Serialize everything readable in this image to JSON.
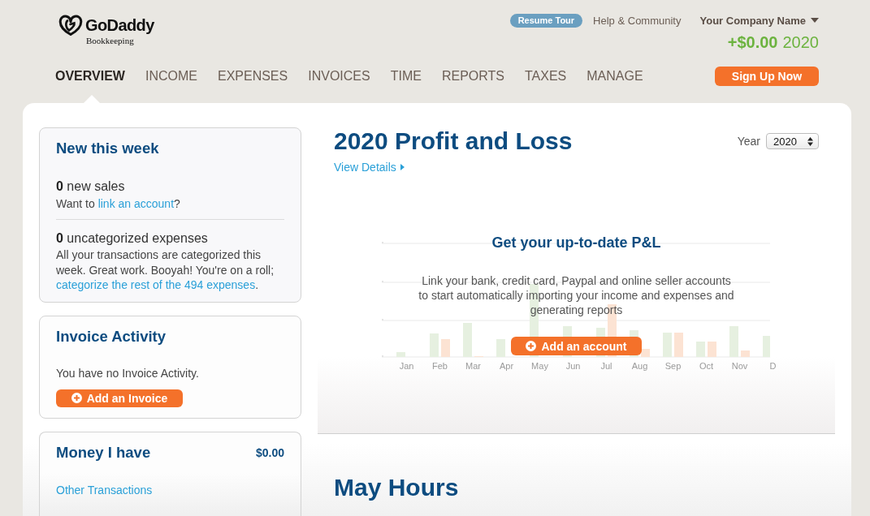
{
  "header": {
    "logo": {
      "brand": "GoDaddy",
      "product": "Bookkeeping"
    },
    "links": {
      "resume_tour": "Resume Tour",
      "help": "Help & Community"
    },
    "company": {
      "name": "Your Company Name"
    },
    "profit": {
      "amount": "+$0.00",
      "year": "2020"
    }
  },
  "nav": {
    "tabs": [
      {
        "label": "OVERVIEW",
        "selected": true
      },
      {
        "label": "INCOME",
        "selected": false
      },
      {
        "label": "EXPENSES",
        "selected": false
      },
      {
        "label": "INVOICES",
        "selected": false
      },
      {
        "label": "TIME",
        "selected": false
      },
      {
        "label": "REPORTS",
        "selected": false
      },
      {
        "label": "TAXES",
        "selected": false
      },
      {
        "label": "MANAGE",
        "selected": false
      }
    ],
    "signup_button": "Sign Up Now"
  },
  "new_this_week": {
    "title": "New this week",
    "sales": {
      "summary": "**0** new sales",
      "prompt": {
        "before": "Want to ",
        "link": "link an account",
        "after": "?"
      }
    },
    "expenses": {
      "summary": "**0** uncategorized expenses",
      "note": {
        "before": "All your transactions are categorized this week. Great work. Booyah! You're on a roll; ",
        "link": "categorize the rest of the 494 expenses",
        "after": "."
      }
    }
  },
  "invoice_activity": {
    "title": "Invoice Activity",
    "message": "You have no Invoice Activity.",
    "button": "Add an Invoice"
  },
  "money_i_have": {
    "title": "Money I have",
    "amount": "$0.00",
    "link": "Other Transactions"
  },
  "profit_and_loss": {
    "title": "2020 Profit and Loss",
    "view_details": "View Details",
    "year": {
      "label": "Year",
      "value": "2020"
    },
    "sample_chart": {
      "months": [
        "Jan",
        "Feb",
        "Mar",
        "Apr",
        "May",
        "Jun",
        "Jul",
        "Aug",
        "Sep",
        "Oct",
        "Nov",
        "D"
      ]
    },
    "empty_state": {
      "title": "Get your up-to-date P&L",
      "text": "Link your bank, credit card, Paypal and online seller accounts to start automatically importing your income and expenses and generating reports",
      "button": "Add an account"
    }
  },
  "hours": {
    "title": "May Hours"
  }
}
